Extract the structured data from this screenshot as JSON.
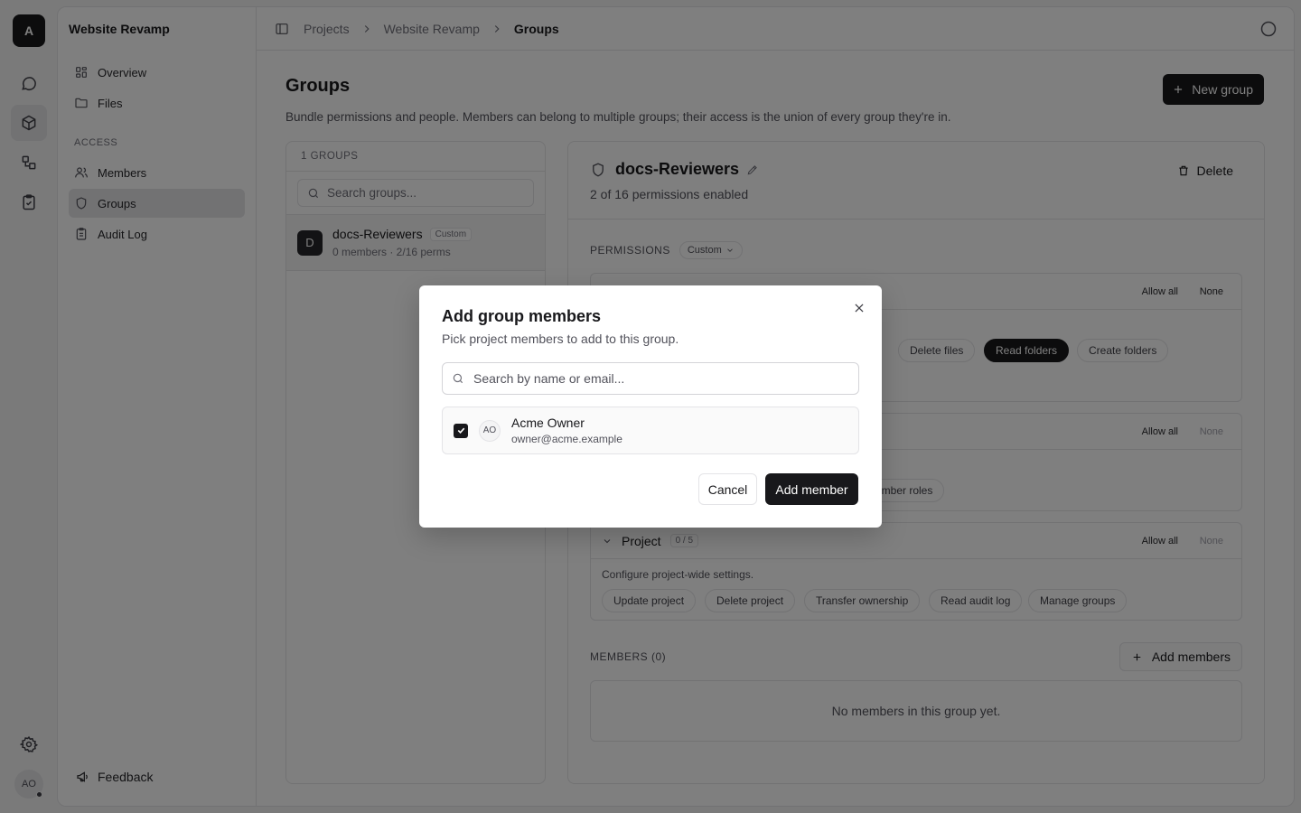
{
  "rail": {
    "brand_letter": "A",
    "avatar": "AO"
  },
  "sidebar": {
    "project_name": "Website Revamp",
    "items": [
      {
        "label": "Overview"
      },
      {
        "label": "Files"
      }
    ],
    "section_label": "ACCESS",
    "access_items": [
      {
        "label": "Members"
      },
      {
        "label": "Groups"
      },
      {
        "label": "Audit Log"
      }
    ],
    "feedback_label": "Feedback"
  },
  "breadcrumb": [
    "Projects",
    "Website Revamp",
    "Groups"
  ],
  "page": {
    "title": "Groups",
    "subtitle": "Bundle permissions and people. Members can belong to multiple groups; their access is the union of every group they're in.",
    "new_group_label": "New group"
  },
  "groups_panel": {
    "header": "1 GROUPS",
    "search_placeholder": "Search groups...",
    "groups": [
      {
        "avatar": "D",
        "name": "docs-Reviewers",
        "badge": "Custom",
        "meta": "0 members · 2/16 perms"
      }
    ]
  },
  "detail": {
    "name": "docs-Reviewers",
    "summary": "2 of 16 permissions enabled",
    "delete_label": "Delete",
    "permissions_label": "PERMISSIONS",
    "preset": "Custom",
    "files_card": {
      "allow_all": "Allow all",
      "none": "None",
      "pills": [
        {
          "label": "Delete files",
          "enabled": false
        },
        {
          "label": "Read folders",
          "enabled": true
        },
        {
          "label": "Create folders",
          "enabled": false
        }
      ]
    },
    "members_card": {
      "allow_all": "Allow all",
      "none": "None",
      "partial_pill": "ember roles"
    },
    "project_card": {
      "title": "Project",
      "count": "0 / 5",
      "allow_all": "Allow all",
      "none": "None",
      "description": "Configure project-wide settings.",
      "pills": [
        "Update project",
        "Delete project",
        "Transfer ownership",
        "Read audit log",
        "Manage groups"
      ]
    },
    "members_label": "MEMBERS (0)",
    "add_members_label": "Add members",
    "empty_text": "No members in this group yet."
  },
  "modal": {
    "title": "Add group members",
    "subtitle": "Pick project members to add to this group.",
    "search_placeholder": "Search by name or email...",
    "members": [
      {
        "initials": "AO",
        "name": "Acme Owner",
        "email": "owner@acme.example",
        "checked": true
      }
    ],
    "cancel_label": "Cancel",
    "confirm_label": "Add member"
  }
}
